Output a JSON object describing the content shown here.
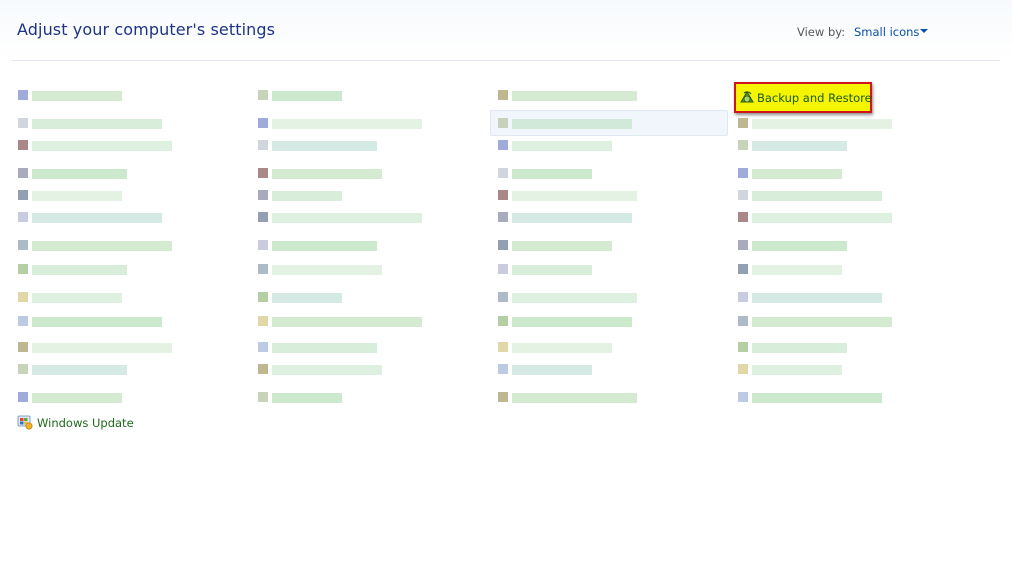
{
  "header": {
    "title": "Adjust your computer's settings"
  },
  "view_by": {
    "label": "View by:",
    "value": "Small icons"
  },
  "highlighted_item": {
    "label": "Backup and Restore",
    "icon": "backup-restore-icon"
  },
  "windows_update": {
    "label": "Windows Update",
    "icon": "windows-update-icon"
  },
  "colors": {
    "title": "#1e3287",
    "link": "#0b4fa8",
    "item_text": "#1c6a1c",
    "highlight_fill": "#f5f500",
    "highlight_border": "#d1141c"
  }
}
